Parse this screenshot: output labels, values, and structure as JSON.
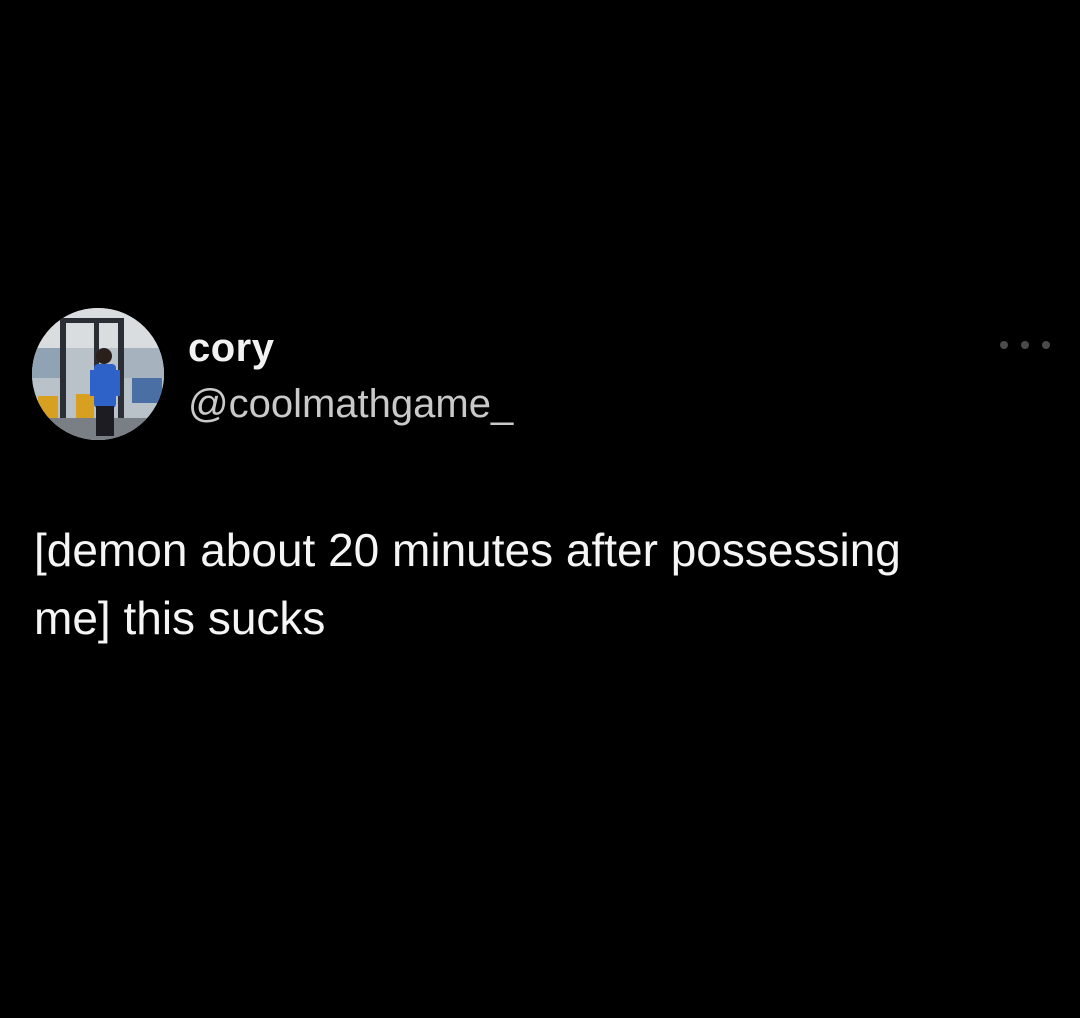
{
  "tweet": {
    "display_name": "cory",
    "handle": "@coolmathgame_",
    "text": "[demon about 20 minutes after possessing\nme] this sucks",
    "more_icon": "more-horizontal-icon",
    "avatar_icon": "profile-photo"
  },
  "colors": {
    "background": "#000000",
    "name": "#f2f2f2",
    "handle": "#c9c9c9",
    "body_text": "#f5f5f5",
    "more_dots": "#4a4a4a"
  }
}
